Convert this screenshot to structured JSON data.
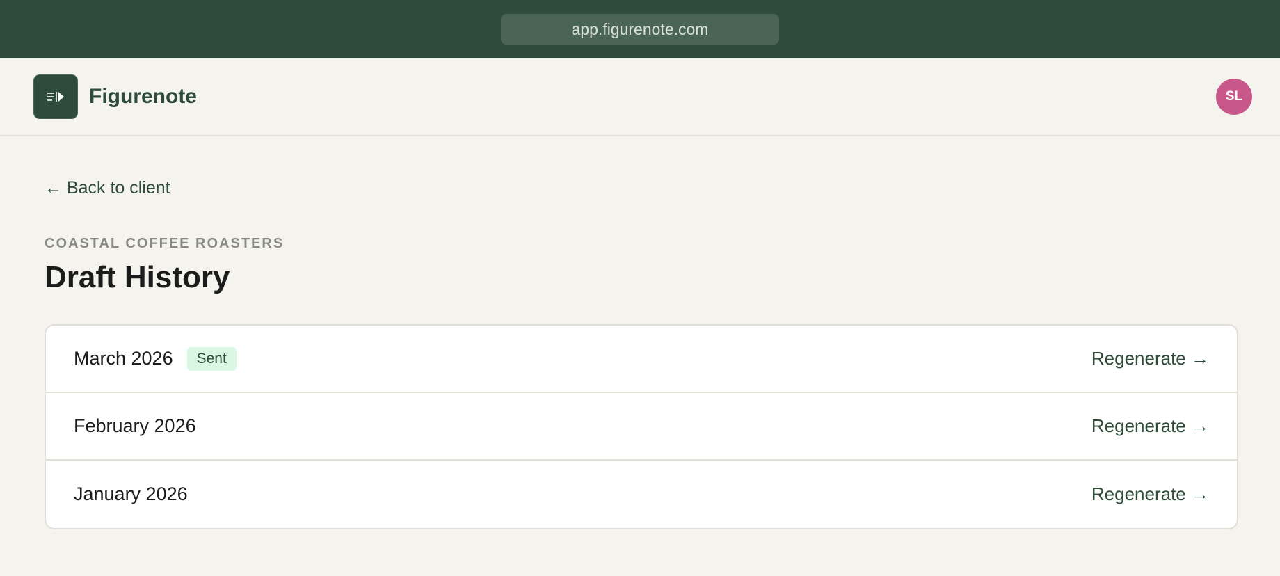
{
  "browser": {
    "url": "app.figurenote.com"
  },
  "header": {
    "brand_name": "Figurenote",
    "logo_icon": "document-play-icon",
    "avatar_initials": "SL"
  },
  "main": {
    "back_link": "← Back to client",
    "client_name": "COASTAL COFFEE ROASTERS",
    "title": "Draft History",
    "drafts": [
      {
        "month": "March 2026",
        "status": "Sent",
        "action": "Regenerate →"
      },
      {
        "month": "February 2026",
        "status": "",
        "action": "Regenerate →"
      },
      {
        "month": "January 2026",
        "status": "",
        "action": "Regenerate →"
      }
    ]
  },
  "colors": {
    "brand": "#2e4c39",
    "background": "#f5f3ee",
    "avatar": "#c9588a",
    "badge_bg": "#d9f7e3"
  }
}
